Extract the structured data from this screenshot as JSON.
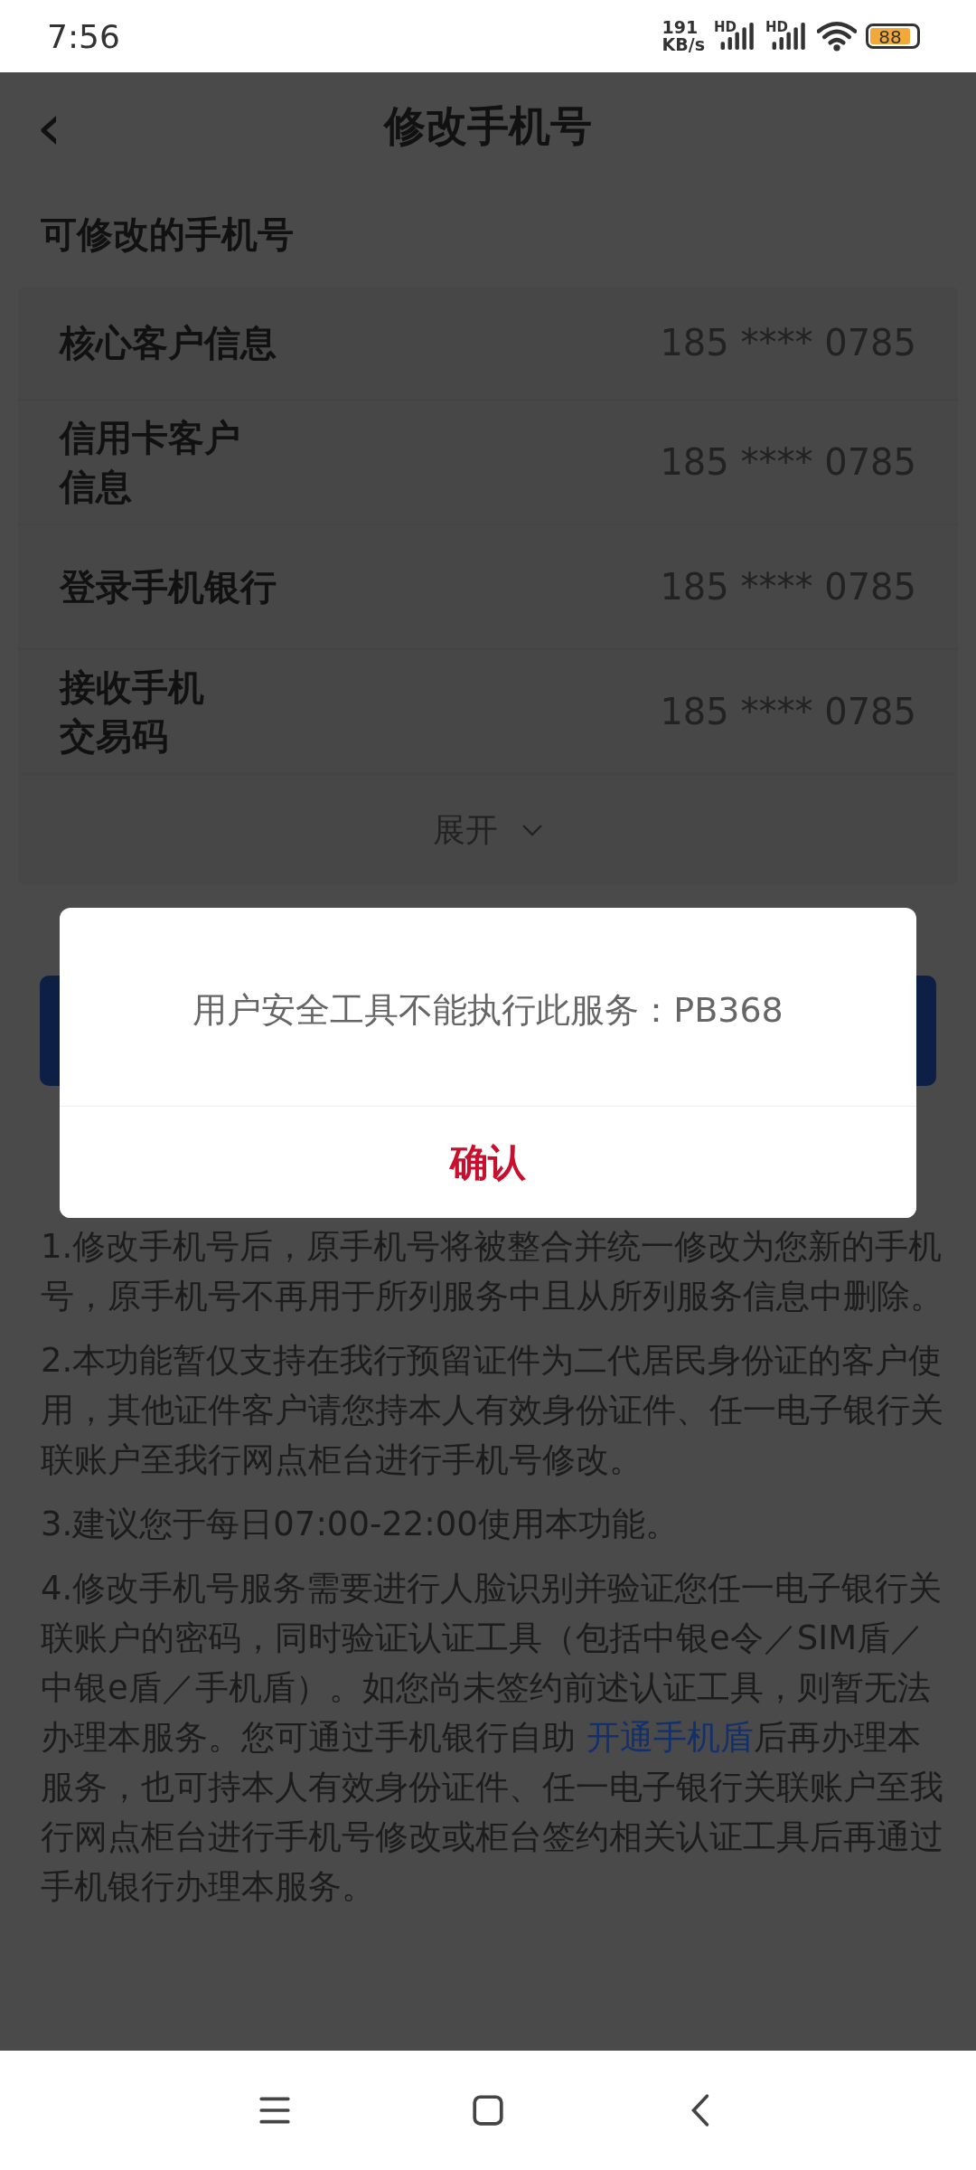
{
  "status_bar": {
    "time": "7:56",
    "speed_value": "191",
    "speed_unit": "KB/s",
    "network_labels": [
      "HD",
      "HD"
    ],
    "battery": "88"
  },
  "header": {
    "back_icon": "‹",
    "title": "修改手机号"
  },
  "section_title": "可修改的手机号",
  "phones": [
    {
      "label_lines": [
        "核心客户信息"
      ],
      "number": "185 **** 0785"
    },
    {
      "label_lines": [
        "信用卡客户",
        "信息"
      ],
      "number": "185 **** 0785"
    },
    {
      "label_lines": [
        "登录手机银行"
      ],
      "number": "185 **** 0785"
    },
    {
      "label_lines": [
        "接收手机",
        "交易码"
      ],
      "number": "185 **** 0785"
    }
  ],
  "expand": {
    "label": "展开",
    "expanded": false
  },
  "notes": [
    {
      "parts": [
        {
          "kind": "text",
          "text": "1.修改手机号后，原手机号将被整合并统一修改为您新的手机号，原手机号不再用于所列服务中且从所列服务信息中删除。"
        }
      ]
    },
    {
      "parts": [
        {
          "kind": "text",
          "text": "2.本功能暂仅支持在我行预留证件为二代居民身份证的客户使用，其他证件客户请您持本人有效身份证件、任一电子银行关联账户至我行网点柜台进行手机号修改。"
        }
      ]
    },
    {
      "parts": [
        {
          "kind": "text",
          "text": "3.建议您于每日07:00-22:00使用本功能。"
        }
      ]
    },
    {
      "parts": [
        {
          "kind": "text",
          "text": "4.修改手机号服务需要进行人脸识别并验证您任一电子银行关联账户的密码，同时验证认证工具（包括中银e令／SIM盾／中银e盾／手机盾）。如您尚未签约前述认证工具，则暂无法办理本服务。您可通过手机银行自助 "
        },
        {
          "kind": "link",
          "text": "开通手机盾"
        },
        {
          "kind": "text",
          "text": "后再办理本服务，也可持本人有效身份证件、任一电子银行关联账户至我行网点柜台进行手机号修改或柜台签约相关认证工具后再通过手机银行办理本服务。"
        }
      ]
    }
  ],
  "dialog": {
    "message": "用户安全工具不能执行此服务：PB368",
    "confirm": "确认"
  }
}
